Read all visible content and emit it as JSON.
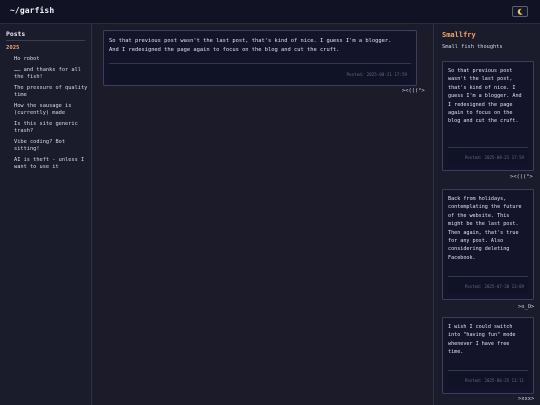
{
  "header": {
    "site_title": "~/garfish",
    "theme_icon": "moon-icon"
  },
  "sidebar": {
    "heading": "Posts",
    "year": "2025",
    "posts": [
      {
        "label": "Ho robot"
      },
      {
        "label": "…… and thanks for all the fish!"
      },
      {
        "label": "The pressure of quality time"
      },
      {
        "label": "How the sausage is (currently) made"
      },
      {
        "label": "Is this site generic trash?"
      },
      {
        "label": "Vibe coding? Bot sitting!"
      },
      {
        "label": "AI is theft - unless I want to use it"
      }
    ]
  },
  "main_post": {
    "text": "So that previous post wasn't the last post, that's kind of nice. I guess I'm a blogger.\nAnd I redesigned the page again to focus on the blog and cut the cruft.",
    "meta": "Posted: 2025-08-21 17:59",
    "fish": "><(((°>"
  },
  "right_panel": {
    "title": "Smallfry",
    "subtitle": "Small fish thoughts",
    "cards": [
      {
        "text": "So that previous post wasn't the last post, that's kind of nice. I guess I'm a blogger. And I redesigned the page again to focus on the blog and cut the cruft.",
        "meta": "Posted: 2025-08-21 17:59",
        "fish": "><(((°>"
      },
      {
        "text": "Back from holidays, contemplating the future of the website. This might be the last post. Then again, that's true for any post. Also considering deleting Facebook.",
        "meta": "Posted: 2025-07-30 13:09",
        "fish": ">o_O>"
      },
      {
        "text": "I wish I could switch into \"having fun\" mode whenever I have free time.",
        "meta": "Posted: 2025-06-25 11:11",
        "fish": ">xxx>"
      }
    ]
  },
  "colors": {
    "accent": "#f3a36b",
    "background": "#1b1b2a",
    "card": "#13142a",
    "text": "#d7d8e3"
  }
}
